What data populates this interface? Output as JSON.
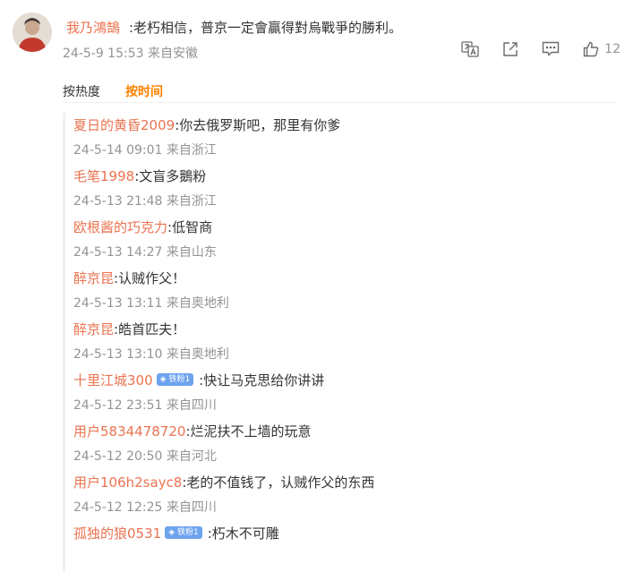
{
  "post": {
    "author": "我乃鴻鵠",
    "text": ":老朽相信，普京一定會贏得對烏戰爭的勝利。",
    "time": "24-5-9 15:53",
    "location": "来自安徽",
    "actions": [
      {
        "icon": "translate-icon"
      },
      {
        "icon": "share-icon"
      },
      {
        "icon": "comment-icon"
      },
      {
        "icon": "like-icon",
        "count": "12"
      }
    ]
  },
  "sort": {
    "heat": "按热度",
    "time": "按时间"
  },
  "replies": [
    {
      "name": "夏日的黄昏2009",
      "badge": "",
      "text": ":你去俄罗斯吧，那里有你爹",
      "time": "24-5-14 09:01",
      "location": "来自浙江"
    },
    {
      "name": "毛笔1998",
      "badge": "",
      "text": ":文盲多鵝粉",
      "time": "24-5-13 21:48",
      "location": "来自浙江"
    },
    {
      "name": "欧根酱的巧克力",
      "badge": "",
      "text": ":低智商",
      "time": "24-5-13 14:27",
      "location": "来自山东"
    },
    {
      "name": "醉京昆",
      "badge": "",
      "text": ":认贼作父！",
      "time": "24-5-13 13:11",
      "location": "来自奥地利"
    },
    {
      "name": "醉京昆",
      "badge": "",
      "text": ":皓首匹夫！",
      "time": "24-5-13 13:10",
      "location": "来自奥地利"
    },
    {
      "name": "十里江城300",
      "badge": "铁粉1",
      "text": ":快让马克思给你讲讲",
      "time": "24-5-12 23:51",
      "location": "来自四川"
    },
    {
      "name": "用户5834478720",
      "badge": "",
      "text": ":烂泥扶不上墙的玩意",
      "time": "24-5-12 20:50",
      "location": "来自河北"
    },
    {
      "name": "用户106h2sayc8",
      "badge": "",
      "text": ":老的不值钱了，认贼作父的东西",
      "time": "24-5-12 12:25",
      "location": "来自四川"
    },
    {
      "name": "孤独的狼0531",
      "badge": "铁粉1",
      "text": ":朽木不可雕",
      "time": "",
      "location": ""
    }
  ],
  "colors": {
    "name": "#eb7350",
    "accent": "#ff8200",
    "meta": "#939393",
    "badge": "#6ea3ee"
  }
}
